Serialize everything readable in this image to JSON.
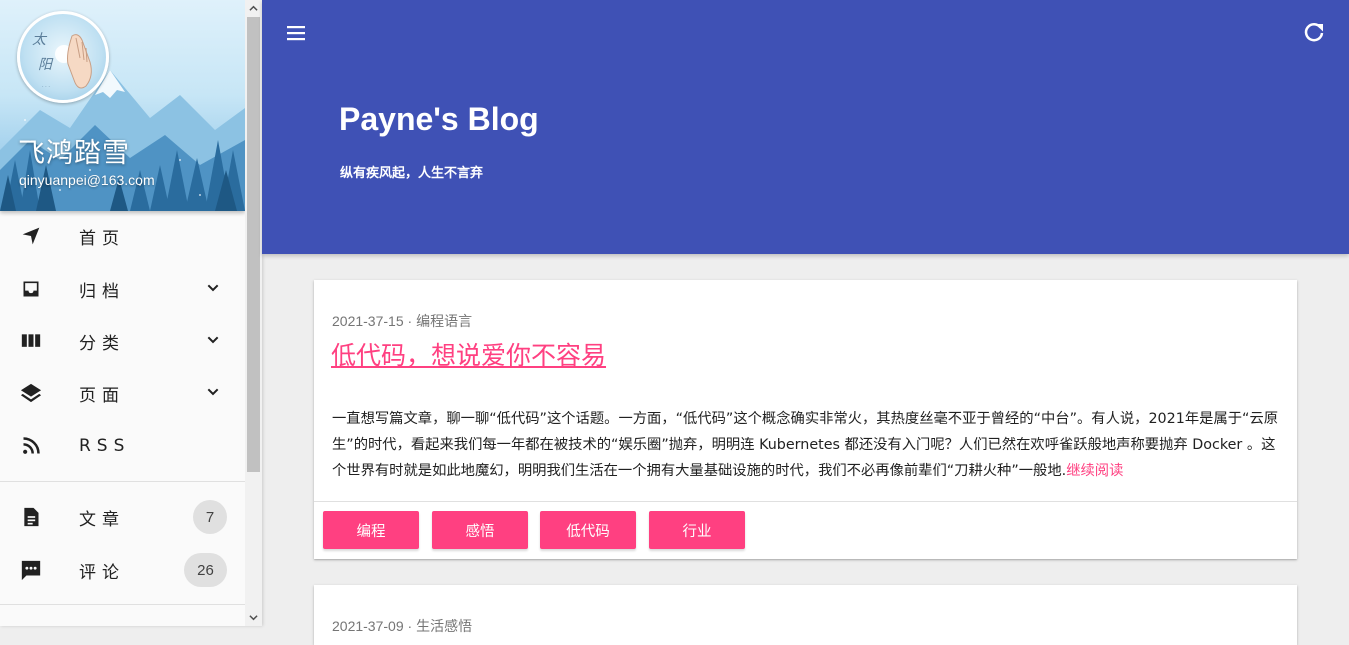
{
  "profile": {
    "name": "飞鸿踏雪",
    "email": "qinyuanpei@163.com"
  },
  "nav": {
    "items": [
      {
        "label": "首页",
        "icon": "navigation-arrow-icon"
      },
      {
        "label": "归档",
        "icon": "inbox-icon"
      },
      {
        "label": "分类",
        "icon": "columns-icon"
      },
      {
        "label": "页面",
        "icon": "layers-icon"
      },
      {
        "label": "RSS",
        "icon": "rss-feed-icon"
      }
    ],
    "stats": [
      {
        "label": "文章",
        "count": "7",
        "icon": "document-icon"
      },
      {
        "label": "评论",
        "count": "26",
        "icon": "comment-icon"
      }
    ]
  },
  "header": {
    "title": "Payne's Blog",
    "subtitle": "纵有疾风起，人生不言弃"
  },
  "posts": [
    {
      "date": "2021-37-15",
      "category": "编程语言",
      "title": "低代码，想说爱你不容易",
      "excerpt": "一直想写篇文章，聊一聊“低代码”这个话题。一方面，“低代码”这个概念确实非常火，其热度丝毫不亚于曾经的“中台”。有人说，2021年是属于“云原生”的时代，看起来我们每一年都在被技术的“娱乐圈”抛弃，明明连 Kubernetes 都还没有入门呢？人们已然在欢呼雀跃般地声称要抛弃 Docker 。这个世界有时就是如此地魔幻，明明我们生活在一个拥有大量基础设施的时代，我们不必再像前辈们“刀耕火种”一般地.",
      "read_more": "继续阅读",
      "tags": [
        "编程",
        "感悟",
        "低代码",
        "行业"
      ]
    },
    {
      "date": "2021-37-09",
      "category": "生活感悟"
    }
  ],
  "colors": {
    "primary": "#3f51b5",
    "accent": "#ff4081"
  }
}
